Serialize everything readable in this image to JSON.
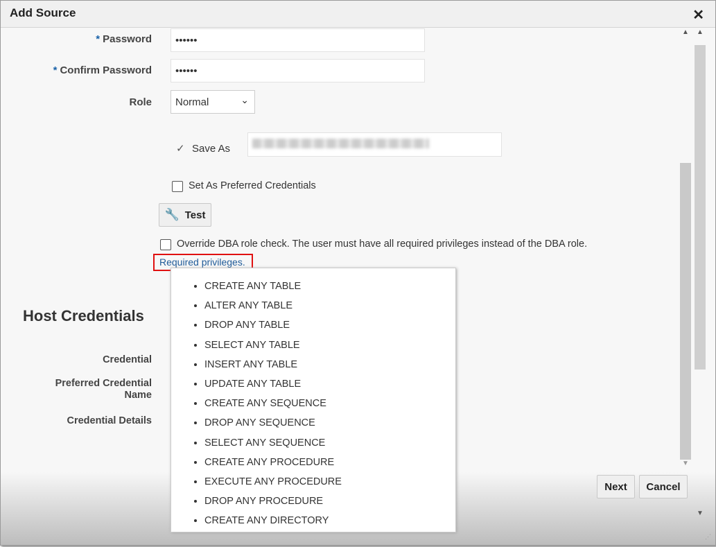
{
  "dialog": {
    "title": "Add Source",
    "close_label": "✕"
  },
  "form": {
    "password": {
      "label": "Password",
      "required": "*",
      "value": "••••••"
    },
    "confirm_password": {
      "label": "Confirm Password",
      "required": "*",
      "value": "••••••"
    },
    "role": {
      "label": "Role",
      "value": "Normal"
    },
    "save_as": {
      "label": "Save As",
      "checkmark": "✓"
    },
    "preferred": {
      "label": "Set As Preferred Credentials"
    },
    "test_button": "Test",
    "override": {
      "label": "Override DBA role check. The user must have all required privileges instead of the DBA role."
    },
    "required_link": "Required privileges."
  },
  "privileges": [
    "CREATE ANY TABLE",
    "ALTER ANY TABLE",
    "DROP ANY TABLE",
    "SELECT ANY TABLE",
    "INSERT ANY TABLE",
    "UPDATE ANY TABLE",
    "CREATE ANY SEQUENCE",
    "DROP ANY SEQUENCE",
    "SELECT ANY SEQUENCE",
    "CREATE ANY PROCEDURE",
    "EXECUTE ANY PROCEDURE",
    "DROP ANY PROCEDURE",
    "CREATE ANY DIRECTORY"
  ],
  "host": {
    "heading": "Host Credentials",
    "credential": "Credential",
    "preferred_name": "Preferred Credential Name",
    "details": "Credential Details"
  },
  "footer": {
    "next": "Next",
    "cancel": "Cancel"
  }
}
